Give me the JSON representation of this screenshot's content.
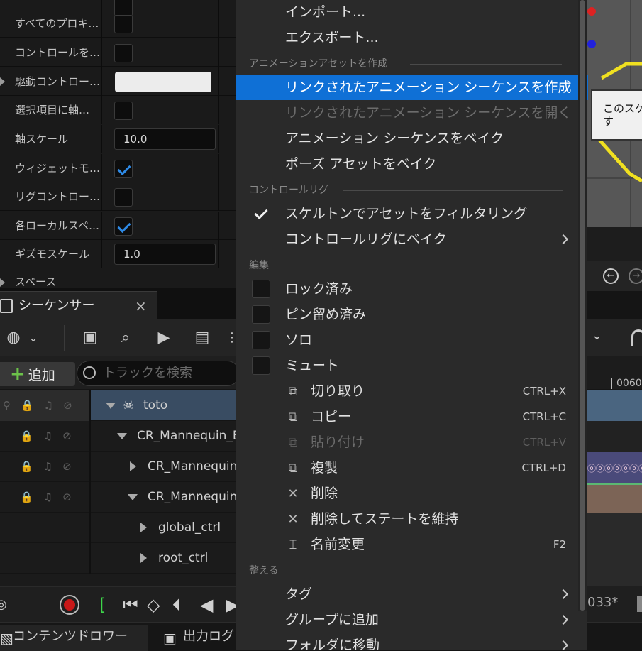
{
  "details": {
    "rows": [
      {
        "label": "すべてのプロキ…",
        "type": "checkbox",
        "checked": false
      },
      {
        "label": "コントロールを…",
        "type": "checkbox",
        "checked": false
      },
      {
        "label": "駆動コントロー…",
        "type": "color",
        "expandable": true
      },
      {
        "label": "選択項目に軸…",
        "type": "checkbox",
        "checked": false
      },
      {
        "label": "軸スケール",
        "type": "number",
        "value": "10.0"
      },
      {
        "label": "ウィジェットモ…",
        "type": "checkbox",
        "checked": true
      },
      {
        "label": "リグコントロー…",
        "type": "checkbox",
        "checked": false
      },
      {
        "label": "各ローカルスペ…",
        "type": "checkbox",
        "checked": true
      },
      {
        "label": "ギズモスケール",
        "type": "number",
        "value": "1.0"
      }
    ],
    "section_cut": "スペース"
  },
  "sequencer": {
    "tab_label": "シーケンサー",
    "close_glyph": "×",
    "add_label": "追加",
    "search_placeholder": "トラックを検索",
    "tree": [
      {
        "label": "toto",
        "selected": true
      },
      {
        "label": "CR_Mannequin_B"
      },
      {
        "label": "CR_Mannequin_"
      },
      {
        "label": "CR_Mannequin_"
      },
      {
        "label": "global_ctrl"
      },
      {
        "label": "root_ctrl"
      }
    ]
  },
  "bottom": {
    "content_drawer": "コンテンツドロワー",
    "output_log": "出力ログ"
  },
  "viewport": {
    "tooltip_line1": "このスケ",
    "tooltip_line2": "す",
    "timecode": "0060",
    "frame": "033*"
  },
  "menu": {
    "items_top": [
      {
        "label": "インポート..."
      },
      {
        "label": "エクスポート..."
      }
    ],
    "section_anim": "アニメーションアセットを作成",
    "anim_items": [
      {
        "label": "リンクされたアニメーション シーケンスを作成",
        "highlight": true
      },
      {
        "label": "リンクされたアニメーション シーケンスを開く",
        "disabled": true
      },
      {
        "label": "アニメーション シーケンスをベイク"
      },
      {
        "label": "ポーズ アセットをベイク"
      }
    ],
    "section_rig": "コントロールリグ",
    "rig_items": [
      {
        "label": "スケルトンでアセットをフィルタリング",
        "checked": true
      },
      {
        "label": "コントロールリグにベイク",
        "submenu": true
      }
    ],
    "section_edit": "編集",
    "edit_checks": [
      {
        "label": "ロック済み"
      },
      {
        "label": "ピン留め済み"
      },
      {
        "label": "ソロ"
      },
      {
        "label": "ミュート"
      }
    ],
    "edit_actions": [
      {
        "label": "切り取り",
        "shortcut": "CTRL+X",
        "icon": "cut-icon"
      },
      {
        "label": "コピー",
        "shortcut": "CTRL+C",
        "icon": "copy-icon"
      },
      {
        "label": "貼り付け",
        "shortcut": "CTRL+V",
        "icon": "paste-icon",
        "disabled": true
      },
      {
        "label": "複製",
        "shortcut": "CTRL+D",
        "icon": "duplicate-icon"
      },
      {
        "label": "削除",
        "shortcut": "",
        "icon": "delete-icon"
      },
      {
        "label": "削除してステートを維持",
        "shortcut": "",
        "icon": "delete-keep-state-icon"
      },
      {
        "label": "名前変更",
        "shortcut": "F2",
        "icon": "rename-icon"
      }
    ],
    "section_organize": "整える",
    "organize_items": [
      {
        "label": "タグ",
        "submenu": true
      },
      {
        "label": "グループに追加",
        "submenu": true
      },
      {
        "label": "フォルダに移動",
        "submenu": true
      }
    ]
  },
  "colors": {
    "highlight": "#0f70d6",
    "checkbox_blue": "#2e8ae6",
    "record_red": "#c81818",
    "add_green": "#6cc24a"
  }
}
